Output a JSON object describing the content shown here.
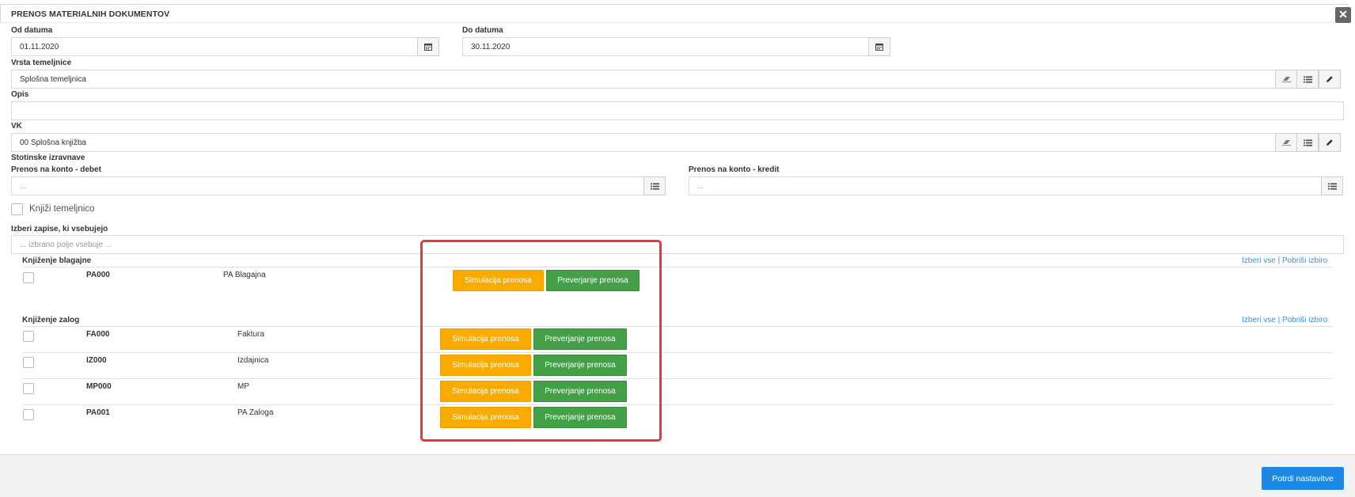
{
  "dialog": {
    "title": "PRENOS MATERIALNIH DOKUMENTOV",
    "close_label": "✕"
  },
  "form": {
    "from_date_label": "Od datuma",
    "from_date_value": "01.11.2020",
    "to_date_label": "Do datuma",
    "to_date_value": "30.11.2020",
    "journal_type_label": "Vrsta temeljnice",
    "journal_type_value": "Splošna temeljnica",
    "description_label": "Opis",
    "description_value": "",
    "vk_label": "VK",
    "vk_value": "00 Splošna knjižba",
    "cent_adjustments_label": "Stotinske izravnave",
    "debit_account_label": "Prenos na konto - debet",
    "debit_account_value": "...",
    "credit_account_label": "Prenos na konto - kredit",
    "credit_account_value": "...",
    "post_journal_label": "Knjiži temeljnico",
    "post_journal_checked": false,
    "filter_label": "Izberi zapise, ki vsebujejo",
    "filter_placeholder": "... izbrano polje vsebuje ..."
  },
  "sections": {
    "cash": {
      "title": "Knjiženje blagajne",
      "select_all": "Izberi vse",
      "separator": " | ",
      "clear_selection": "Pobriši izbiro",
      "rows": [
        {
          "code": "PA000",
          "name": "PA Blagajna",
          "checked": false
        }
      ]
    },
    "inventory": {
      "title": "Knjiženje zalog",
      "select_all": "Izberi vse",
      "separator": " | ",
      "clear_selection": "Pobriši izbiro",
      "rows": [
        {
          "code": "FA000",
          "name": "Faktura",
          "checked": false
        },
        {
          "code": "IZ000",
          "name": "Izdajnica",
          "checked": false
        },
        {
          "code": "MP000",
          "name": "MP",
          "checked": false
        },
        {
          "code": "PA001",
          "name": "PA Zaloga",
          "checked": false
        }
      ]
    }
  },
  "buttons": {
    "simulate": "Simulacija prenosa",
    "verify": "Preverjanje prenosa",
    "confirm": "Potrdi nastavitve"
  },
  "colors": {
    "simulate_bg": "#f9ab00",
    "verify_bg": "#43a047",
    "confirm_bg": "#1e88e5",
    "link": "#3b8fd9",
    "highlight": "#e53935"
  }
}
